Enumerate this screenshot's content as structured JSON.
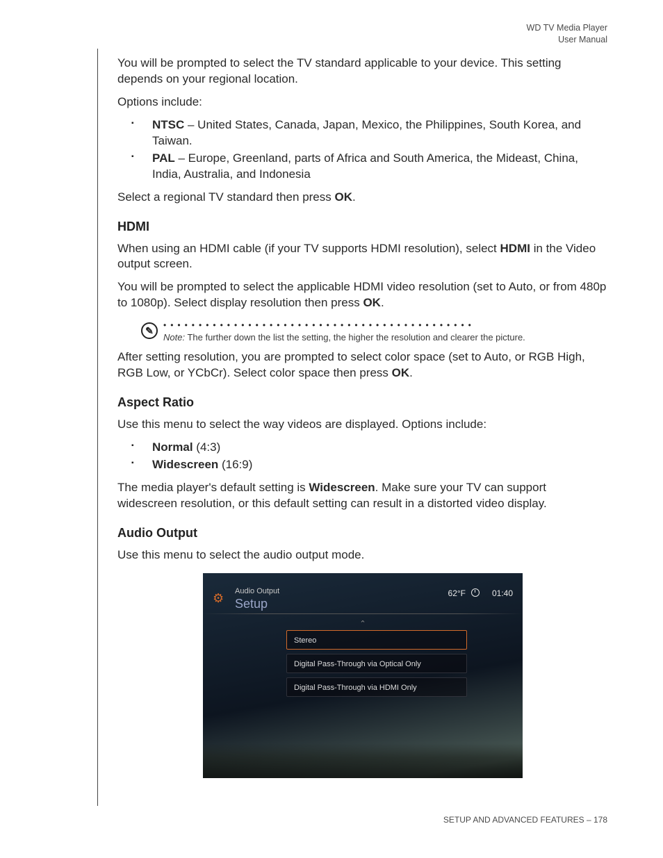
{
  "header": {
    "line1": "WD TV Media Player",
    "line2": "User Manual"
  },
  "intro": {
    "p1": "You will be prompted to select the TV standard applicable to your device. This setting depends on your regional location.",
    "p2": "Options include:"
  },
  "tv_standards": [
    {
      "name": "NTSC",
      "desc": " – United States, Canada, Japan, Mexico, the Philippines, South Korea, and Taiwan."
    },
    {
      "name": "PAL",
      "desc": " – Europe, Greenland, parts of Africa and South America, the Mideast, China, India, Australia, and Indonesia"
    }
  ],
  "select_region_pre": "Select a regional TV standard then press ",
  "ok_label": "OK",
  "period": ".",
  "hdmi": {
    "heading": "HDMI",
    "p1_pre": "When using an HDMI cable (if your TV supports HDMI resolution), select ",
    "p1_bold": "HDMI",
    "p1_post": " in the Video output screen.",
    "p2_pre": "You will be prompted to select the applicable HDMI video resolution (set to Auto, or from 480p to 1080p). Select display resolution then press ",
    "note_label": "Note:",
    "note_text": " The further down the list the setting, the higher the resolution and clearer the picture.",
    "p3_pre": "After setting resolution, you are prompted to select color space (set to Auto, or RGB High, RGB Low, or YCbCr). Select color space then press "
  },
  "aspect": {
    "heading": "Aspect Ratio",
    "p1": "Use this menu to select the way videos are displayed. Options include:",
    "options": [
      {
        "name": "Normal",
        "desc": " (4:3)"
      },
      {
        "name": "Widescreen",
        "desc": " (16:9)"
      }
    ],
    "p2_pre": "The media player's default setting is ",
    "p2_bold": "Widescreen",
    "p2_post": ". Make sure your TV can support widescreen resolution, or this default setting can result in a distorted video display."
  },
  "audio": {
    "heading": "Audio Output",
    "p1": "Use this menu to select the audio output mode."
  },
  "screenshot": {
    "breadcrumb": "Audio Output",
    "title": "Setup",
    "temp": "62°F",
    "time": "01:40",
    "items": [
      {
        "label": "Stereo",
        "selected": true
      },
      {
        "label": "Digital Pass-Through via Optical Only",
        "selected": false
      },
      {
        "label": "Digital Pass-Through via HDMI Only",
        "selected": false
      }
    ]
  },
  "footer": {
    "section": "SETUP AND ADVANCED FEATURES",
    "sep": " – ",
    "page": "178"
  }
}
